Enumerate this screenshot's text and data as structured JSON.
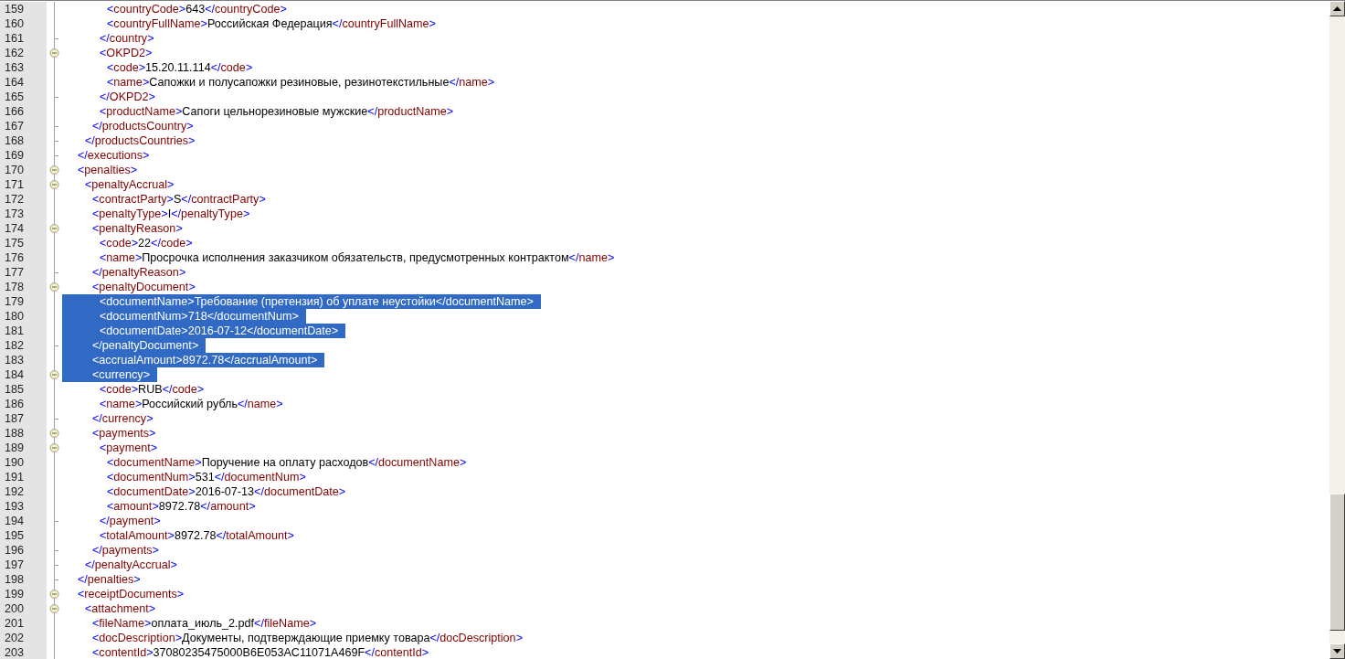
{
  "editor": {
    "lines": [
      {
        "number": "159",
        "kind": "line",
        "selected": false,
        "text": "        <countryCode>643</countryCode>"
      },
      {
        "number": "160",
        "kind": "line",
        "selected": false,
        "text": "        <countryFullName>Российская Федерация</countryFullName>"
      },
      {
        "number": "161",
        "kind": "end",
        "selected": false,
        "text": "      </country>"
      },
      {
        "number": "162",
        "kind": "open",
        "selected": false,
        "text": "      <OKPD2>"
      },
      {
        "number": "163",
        "kind": "line",
        "selected": false,
        "text": "        <code>15.20.11.114</code>"
      },
      {
        "number": "164",
        "kind": "line",
        "selected": false,
        "text": "        <name>Сапожки и полусапожки резиновые, резинотекстильные</name>"
      },
      {
        "number": "165",
        "kind": "end",
        "selected": false,
        "text": "      </OKPD2>"
      },
      {
        "number": "166",
        "kind": "line",
        "selected": false,
        "text": "      <productName>Сапоги цельнорезиновые мужские</productName>"
      },
      {
        "number": "167",
        "kind": "end",
        "selected": false,
        "text": "    </productsCountry>"
      },
      {
        "number": "168",
        "kind": "end",
        "selected": false,
        "text": "  </productsCountries>"
      },
      {
        "number": "169",
        "kind": "end",
        "selected": false,
        "text": "</executions>"
      },
      {
        "number": "170",
        "kind": "open",
        "selected": false,
        "text": "<penalties>"
      },
      {
        "number": "171",
        "kind": "open",
        "selected": false,
        "text": "  <penaltyAccrual>"
      },
      {
        "number": "172",
        "kind": "line",
        "selected": false,
        "text": "    <contractParty>S</contractParty>"
      },
      {
        "number": "173",
        "kind": "line",
        "selected": false,
        "text": "    <penaltyType>I</penaltyType>"
      },
      {
        "number": "174",
        "kind": "open",
        "selected": false,
        "text": "    <penaltyReason>"
      },
      {
        "number": "175",
        "kind": "line",
        "selected": false,
        "text": "      <code>22</code>"
      },
      {
        "number": "176",
        "kind": "line",
        "selected": false,
        "text": "      <name>Просрочка исполнения заказчиком обязательств, предусмотренных контрактом</name>"
      },
      {
        "number": "177",
        "kind": "end",
        "selected": false,
        "text": "    </penaltyReason>"
      },
      {
        "number": "178",
        "kind": "open",
        "selected": false,
        "text": "    <penaltyDocument>"
      },
      {
        "number": "179",
        "kind": "line",
        "selected": true,
        "text": "      <documentName>Требование (претензия) об уплате неустойки</documentName>"
      },
      {
        "number": "180",
        "kind": "line",
        "selected": true,
        "text": "      <documentNum>718</documentNum>"
      },
      {
        "number": "181",
        "kind": "line",
        "selected": true,
        "text": "      <documentDate>2016-07-12</documentDate>"
      },
      {
        "number": "182",
        "kind": "end",
        "selected": true,
        "text": "    </penaltyDocument>"
      },
      {
        "number": "183",
        "kind": "line",
        "selected": true,
        "text": "    <accrualAmount>8972.78</accrualAmount>"
      },
      {
        "number": "184",
        "kind": "open",
        "selected": true,
        "text": "    <currency>"
      },
      {
        "number": "185",
        "kind": "line",
        "selected": false,
        "text": "      <code>RUB</code>"
      },
      {
        "number": "186",
        "kind": "line",
        "selected": false,
        "text": "      <name>Российский рубль</name>"
      },
      {
        "number": "187",
        "kind": "end",
        "selected": false,
        "text": "    </currency>"
      },
      {
        "number": "188",
        "kind": "open",
        "selected": false,
        "text": "    <payments>"
      },
      {
        "number": "189",
        "kind": "open",
        "selected": false,
        "text": "      <payment>"
      },
      {
        "number": "190",
        "kind": "line",
        "selected": false,
        "text": "        <documentName>Поручение на оплату расходов</documentName>"
      },
      {
        "number": "191",
        "kind": "line",
        "selected": false,
        "text": "        <documentNum>531</documentNum>"
      },
      {
        "number": "192",
        "kind": "line",
        "selected": false,
        "text": "        <documentDate>2016-07-13</documentDate>"
      },
      {
        "number": "193",
        "kind": "line",
        "selected": false,
        "text": "        <amount>8972.78</amount>"
      },
      {
        "number": "194",
        "kind": "end",
        "selected": false,
        "text": "      </payment>"
      },
      {
        "number": "195",
        "kind": "line",
        "selected": false,
        "text": "      <totalAmount>8972.78</totalAmount>"
      },
      {
        "number": "196",
        "kind": "end",
        "selected": false,
        "text": "    </payments>"
      },
      {
        "number": "197",
        "kind": "end",
        "selected": false,
        "text": "  </penaltyAccrual>"
      },
      {
        "number": "198",
        "kind": "end",
        "selected": false,
        "text": "</penalties>"
      },
      {
        "number": "199",
        "kind": "open",
        "selected": false,
        "text": "<receiptDocuments>"
      },
      {
        "number": "200",
        "kind": "open",
        "selected": false,
        "text": "  <attachment>"
      },
      {
        "number": "201",
        "kind": "line",
        "selected": false,
        "text": "    <fileName>оплата_июль_2.pdf</fileName>"
      },
      {
        "number": "202",
        "kind": "line",
        "selected": false,
        "text": "    <docDescription>Документы, подтверждающие приемку товара</docDescription>"
      },
      {
        "number": "203",
        "kind": "line",
        "selected": false,
        "text": "    <contentId>37080235475000B6E053AC11071A469F</contentId>"
      }
    ]
  }
}
